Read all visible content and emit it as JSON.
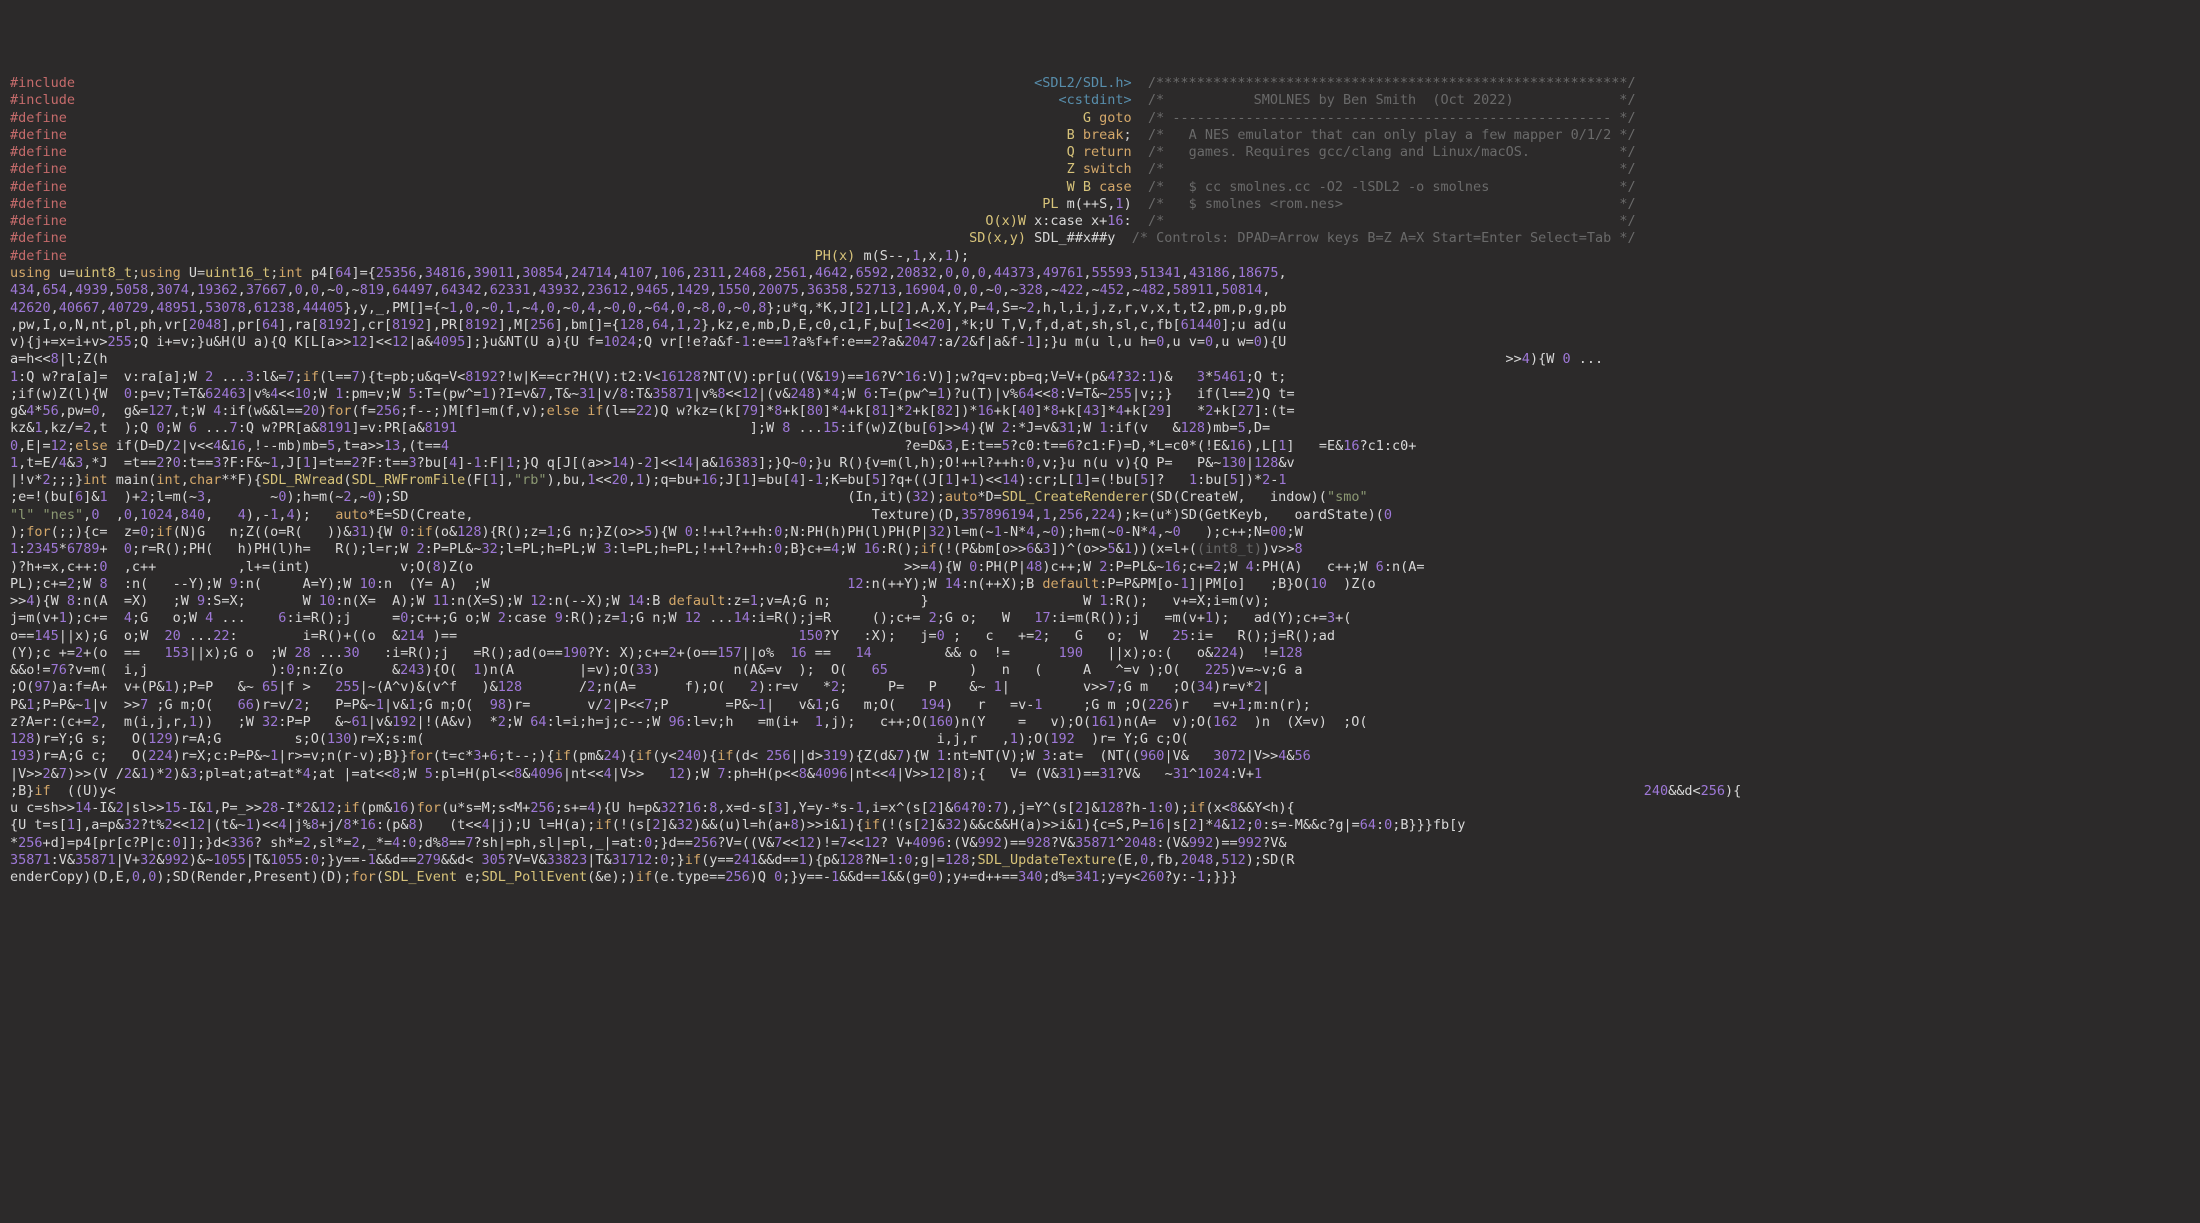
{
  "preproc": {
    "include": "#include",
    "define": "#define"
  },
  "includes": {
    "sdl": "<SDL2/SDL.h>",
    "cstdint": "<cstdint>"
  },
  "macros": {
    "G": {
      "name": "G",
      "body": "goto"
    },
    "B": {
      "name": "B",
      "body": "break;"
    },
    "Q": {
      "name": "Q",
      "body": "return"
    },
    "Z": {
      "name": "Z",
      "body": "switch"
    },
    "W": {
      "name": "W",
      "body": "B case"
    },
    "PL": {
      "name": "PL",
      "body": "m(++S,1)"
    },
    "O": {
      "name": "O(x)W",
      "body": "x:case x+16:"
    },
    "SD": {
      "name": "SD(x,y)",
      "body": "SDL_##x##y"
    },
    "PH": {
      "name": "PH(x)",
      "body": "m(S--,1,x,1);"
    }
  },
  "comments": {
    "topbar": "/**********************************************************/",
    "title": "/*           SMOLNES by Ben Smith  (Oct 2022)             */",
    "dashes": "/* ------------------------------------------------------ */",
    "desc1": "/*   A NES emulator that can only play a few mapper 0/1/2 */",
    "desc2": "/*   games. Requires gcc/clang and Linux/macOS.           */",
    "blank1": "/*                                                        */",
    "build": "/*   $ cc smolnes.cc -O2 -lSDL2 -o smolnes                */",
    "run": "/*   $ smolnes <rom.nes>                                  */",
    "blank2": "/*                                                        */",
    "controls": "/* Controls: DPAD=Arrow keys B=Z A=X Start=Enter Select=Tab */",
    "intcast": "(int8_t)"
  },
  "kw": {
    "using": "using",
    "int": "int",
    "if": "if",
    "else": "else",
    "for": "for",
    "auto": "auto",
    "case": "case",
    "default": "default",
    "char": "char"
  },
  "types": {
    "u8": "uint8_t",
    "u16": "uint16_t"
  },
  "fns": {
    "rwread": "SDL_RWread",
    "rwfromfile": "SDL_RWFromFile",
    "createrenderer": "SDL_CreateRenderer",
    "updatetexture": "SDL_UpdateTexture",
    "pollevent": "SDL_PollEvent",
    "event": "SDL_Event"
  },
  "strings": {
    "rb": "\"rb\"",
    "smo": "\"smo\"",
    "l": "\"l\"",
    "nes": "\"nes\""
  },
  "arrays": {
    "p4": "p4[64]={25356,34816,39011,30854,24714,4107,106,2311,2468,2561,4642,6592,20832,0,0,0,44373,49761,55593,51341,43186,18675,",
    "p4_2": "434,654,4939,5058,3074,19362,37667,0,0,~0,~819,64497,64342,62331,43932,23612,9465,1429,1550,20075,36358,52713,16904,0,0,~0,~328,~422,~452,~482,58911,50814,",
    "p4_3": "42620,40667,40729,48951,53078,61238,44405},y,_,PM[]={~1,0,~0,1,~4,0,~0,4,~0,0,~64,0,~8,0,~0,8};u*q,*K,J[2],L[2],A,X,Y,P=4,S=~2,h,l,i,j,z,r,v,x,t,t2,pm,p,g,pb",
    "p4_4": ",pw,I,o,N,nt,pl,ph,vr[2048],pr[64],ra[8192],cr[8192],PR[8192],M[256],bm[]={128,64,1,2},kz,e,mb,D,E,c0,c1,F,bu[1<<20],*k;U T,V,f,d,at,sh,sl,c,fb[61440];u ad(u",
    "p4_5": "v){j+=x=i+v>255;Q i+=v;}u&H(U a){Q K[L[a>>12]<<12|a&4095];}u&NT(U a){U f=1024;Q vr[!e?a&f-1:e==1?a%f+f:e==2?a&2047:a/2&f|a&f-1];}u m(u l,u h=0,u v=0,u w=0){U"
  },
  "lines": {
    "l01a": "a=h<<8|l;Z(h",
    "l01b": ">>4){W 0 ...",
    "l02a": "1:Q w?ra[a]=",
    "l02b": "  v:ra[a];W 2 ...3:l&=7;",
    "l02c": "(l==7){t=pb;u&q=V<8192?!w|K==cr?H(V):t2:V<16128?NT(V):pr[u((V&19)==16?V^16:V)];w?q=v:pb=q;V=V+(p&4?32:1)&",
    "l02d": "   3*5461;Q t;",
    "l03a": ";if(w)Z(l){W",
    "l03b": "  0:p=v;T=T&62463|v%4<<10;W 1:pm=v;W 5:T=(pw^=1)?I=v&7,T&~31|v/8:T&35871|v%8<<12|(v&248)*4;W 6:T=(pw^=1)?u(T)|v%64<<8:V=T&~255|v;;}",
    "l03c": "   if(l==2)Q t=",
    "l04a": "g&4*56,pw=0,",
    "l04b": "  g&=127,t;W 4:if(w&&l==20)",
    "l04c": "(f=256;f--;)M[f]=m(f,v);",
    "l04d": "(l==22)Q w?kz=(k[79]*8+k[80]*4+k[81]*2+k[82])*16+k[40]*8+k[43]*4+k[29]",
    "l04e": "   *2+k[27]:(t=",
    "l05a": "kz&1,kz/=2,t",
    "l05b": "  );Q 0;W 6 ...7:Q w?PR[a&8191]=v:PR[a&8191",
    "l05c": "];W 8 ...15:if(w)Z(bu[6]>>4){W 2:*J=v&31;W 1:if(v",
    "l05d": "   &128)mb=5,D=",
    "l06a": "0,E|=12;",
    "l06b": " if(D=D/2|v<<4&16,!--mb)mb=5,t=a>>13,(t==4",
    "l06c": "?e=D&3,E:t==5?c0:t==6?c1:F)=D,*L=c0*(!E&16),L[1]",
    "l06d": "   =E&16?c1:c0+",
    "l07a": "1,t=E/4&3,*J",
    "l07b": "  =t==2?0:t==3?F:F&~1,J[1]=t==2?F:t==3?bu[4]-1:F|1;}Q q[J[(a>>14)-2]<<14|a&16383];}Q~0;}u R(){v=m(l,h);O!++l?++h:0,v;}u n(u v){Q P=",
    "l07c": "   P&~130|128&v",
    "l08a": "|!v*2;;;}",
    "l08b": " main(",
    "l08c": ",",
    "l08d": "**F){",
    "l08e": "(",
    "l08f": "(F[1],",
    "l08g": "),bu,1<<20,1);q=bu+16;J[1]=bu[4]-1;K=bu[5]?q+((J[1]+1)<<14):cr;L[1]=(!bu[5]?",
    "l08h": "   1:bu[5])*2-1",
    "l09a": ";e=!(bu[6]&1",
    "l09b": "  )+2;l=m(~3,       ~0);h=m(~2,~0);SD",
    "l09c": "(In,it)(32);",
    "l09d": "*D=",
    "l09e": "(SD(CreateW,",
    "l09f": "   indow)(",
    "l10a": ",0",
    "l10b": "  ,0,1024,840,   4),-1,4);   ",
    "l10c": "*E=SD(Create,",
    "l10d": "Texture)(D,357896194,1,256,224);k=(u*)SD(GetKeyb,",
    "l10e": "   oardState)(0",
    "l11a": ");",
    "l11b": "(;;){c=",
    "l11c": "  z=0;",
    "l11d": "(N)G   n;Z((o=R(   ))&31){W 0:",
    "l11e": "(o&128){R();z=1;G n;}Z(o>>5){W 0:!++l?++h:0;N:PH(h)PH(l)PH(P|32)l=m(~1-N*4,~0);h=m(~0-N*4,~0",
    "l11f": "   );c++;N=00;W",
    "l12a": "1:2345*6789+",
    "l12b": "  0;r=R();PH(   h)PH(l)h=   R();l=r;W 2:P=PL&~32;l=PL;h=PL;W 3:l=PL;h=PL;!++l?++h:0;B}c+=4;W 16:R();",
    "l12c": "(!(P&bm[o>>6&3])^(o>>5&1))(x=l+(",
    "l12d": ")v>>8",
    "l13a": ")?h+=x,c++:0",
    "l13b": "  ,c++          ,l+=(int)           v;O(8)Z(o",
    "l13c": ">>=4){W 0:PH(P|48)c++;W 2:P=PL&~16;c+=2;W 4:PH(A)",
    "l13d": "   c++;W 6:n(A=",
    "l14a": "PL);c+=2;W 8",
    "l14b": "  :n(   --Y);W 9:n(     A=Y);W 10:n  (Y= A)  ;W",
    "l14c": "12:n(++Y);W 14:n(++X);B ",
    "l14d": ":P=P&PM[o-1]|PM[o]",
    "l14e": "   ;B}O(10  )Z(o",
    "l15a": ">>4){W 8:n(A",
    "l15b": "  =X)   ;W 9:S=X;       W 10:n(X=  A);W 11:n(X=S);W 12:n(--X);W 14:B ",
    "l15c": ":z=1;v=A;G n;",
    "l15d": "}",
    "l15e": "W 1:R();",
    "l15f": "   v+=X;i=m(v);",
    "l16a": "j=m(v+1);c+=",
    "l16b": "  4;G   o;W 4 ...    6:i=R();j     =0;c++;G o;W 2:case 9:R();z=1;G n;W 12 ...14:i=R();j=R     ();c+= 2;G o;   W   17:i=m(R());j",
    "l16c": "   =m(v+1);",
    "l16d": "   ad(Y);c+=3+(",
    "l17a": "o==145||x);G",
    "l17b": "  o;W  20 ...22:        i=R()+((o  &214 )==",
    "l17c": "150?Y   :X);   j=0 ;   c   +=2;   G   o;  W   25:i=",
    "l17d": "   R();j=R();ad",
    "l18a": "(Y);c +=2+(o",
    "l18b": "  ==   153||x);G o  ;W 28 ...30   :i=R();j   =R();ad(o==190?Y: X);c+=2+(o==157||o%  16 ==   14         && o  !=      190   ||x);o:(",
    "l18c": "   o&224)  !=128",
    "l19a": "&&o!=76?v=m(",
    "l19b": "  i,j               ):0;n:Z(o      &243){O(  1)n(A        |=v);O(33)         n(A&=v  );  O(   65          )   n   (     A   ^=v );O(",
    "l19c": "   225)v=~v;G a",
    "l20a": ";O(97)a:f=A+",
    "l20b": "  v+(P&1);P=P   &~ 65|f >   255|~(A^v)&(v^f   )&128       /2;n(A=      f);O(   2):r=v   *2;     P=   P    &~ 1|         v>>7;G m",
    "l20c": "   ;O(34)r=v*2|",
    "l21a": "P&1;P=P&~1|v",
    "l21b": "  >>7 ;G m;O(   66)r=v/2;   P=P&~1|v&1;G m;O(  98)r=       v/2|P<<7;P       =P&~1|   v&1;G   m;O(   194)   r   =v-1     ;G m ;O(226)r",
    "l21c": "   =v+1;m:n(r);",
    "l22a": "z?A=r:(c+=2,",
    "l22b": "  m(i,j,r,1))   ;W 32:P=P   &~61|v&192|!(A&v)  *2;W 64:l=i;h=j;c--;W 96:l=v;h   =m(i+  1,j);   c++;O(160)n(Y    =   v);O(161)n(A=  v);O(162  )n  (X=v)  ;O(",
    "l23a": "128)r=Y;G s;",
    "l23b": "   O(129)r=A;G         s;O(130)r=X;s:m(",
    "l23c": "i,j,r",
    "l23d": "   ,1);O(192  )r= Y;G c;O(",
    "l24a": "193)r=A;G c;",
    "l24b": "   O(224)r=X;c:P=P&~1|r>=v;n(r-v);B}}",
    "l24c": "(t=c*3+6;t--;){",
    "l24d": "(pm&24){",
    "l24e": "(y<240){",
    "l24f": "(d< 256||d>319){Z(d&7){W 1:nt=NT(V);W 3:at=  (NT((960|V&",
    "l24g": "   3072|V>>4&56",
    "l25a": "|V>>2&7)>>(V",
    "l25b": " /2&1)*2)&3;pl=at;at=at*4;at |=at<<8;W 5:pl=H(pl<<8&4096|nt<<4|V>>   12);W 7:ph=H(p<<8&4096|nt<<4|V>>12|8);{   V= (V&31)==31?V&",
    "l25c": "   ~31^1024:V+1",
    "l26a": ";B}",
    "l26b": "  ((U)y<",
    "l26c": "   240&&d<256){",
    "l27a": "u c=sh>>14-I&2|sl>>15-I&1,P=_>>28-I*2&12;",
    "l27b": "(pm&16)",
    "l27c": "(u*s=M;s<M+256;s+=4){U h=p&32?16:8,x=d-s[3],Y=y-*s-1,i=x^(s[2]&64?0:7),j=Y^(s[2]&128?h-1:0);",
    "l27d": "(x<8&&Y<h){",
    "l28a": "{U t=s[1],a=p&32?t%2<<12|(t&~1)<<4|j%8+j/8*16:(p&8)   (t<<4|j);U l=H(a);",
    "l28b": "(!(s[2]&32)&&(u)l=h(a+8)>>i&1){",
    "l28c": "(!(s[2]&32)&&c&&H(a)>>i&1){c=S,P=16|s[2]*4&12;0:s=-M&&c?g|=64:0;B}}}fb[y",
    "l29a": "*256+d]=p4[pr[c?P|c:0]];}d<336? sh*=2,sl*=2,_*=4:0;d%8==7?sh|=ph,sl|=pl,_|=at:0;}d==256?V=((V&7<<12)!=7<<12? V+4096:(V&992)==928?V&35871^2048:(V&992)==992?V&",
    "l30a": "35871:V&35871|V+32&992)&~1055|T&1055:0;}y==-1&&d==279&&d< 305?V=V&33823|T&31712:0;}",
    "l30b": "(y==241&&d==1){p&128?N=1:0;g|=128;",
    "l30c": "(E,0,fb,2048,512);SD(R",
    "l31a": "enderCopy)(D,E,0,0);SD(Render,Present)(D);",
    "l31b": "(",
    "l31c": " e;",
    "l31d": "(&e);)",
    "l31e": "(e.type==256)Q 0;}y==-1&&d==1&&(g=0);y+=d++==340;d%=341;y=y<260?y:-1;}}}"
  }
}
